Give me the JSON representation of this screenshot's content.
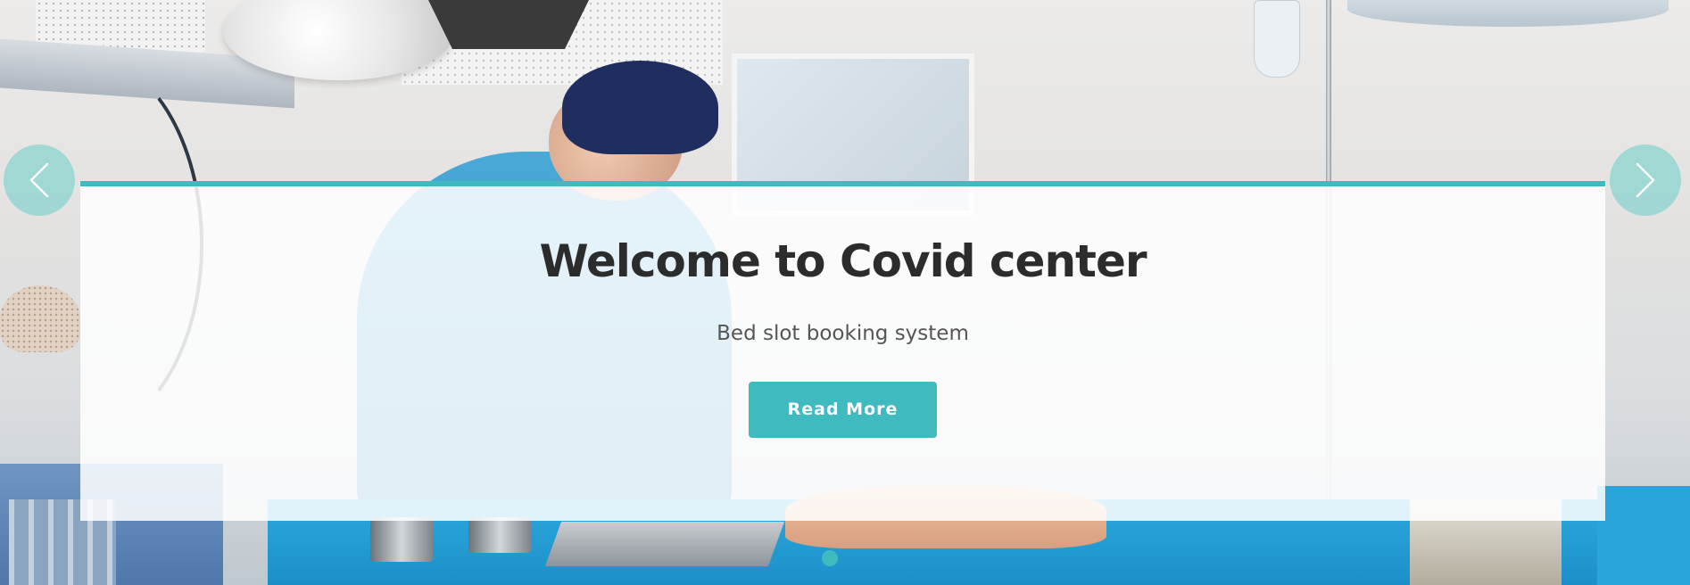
{
  "carousel": {
    "slide": {
      "title": "Welcome to Covid center",
      "subtitle": "Bed slot booking system",
      "cta_label": "Read More"
    },
    "background_image": "operating-room-surgeon-photo",
    "prev_icon": "chevron-left-icon",
    "next_icon": "chevron-right-icon",
    "slide_count": 1,
    "active_slide": 1
  },
  "colors": {
    "accent": "#3fbbc0",
    "title": "#2c2c2c",
    "subtitle": "#555555",
    "card_background": "#ffffff",
    "arrow_background": "#76d0cc"
  }
}
